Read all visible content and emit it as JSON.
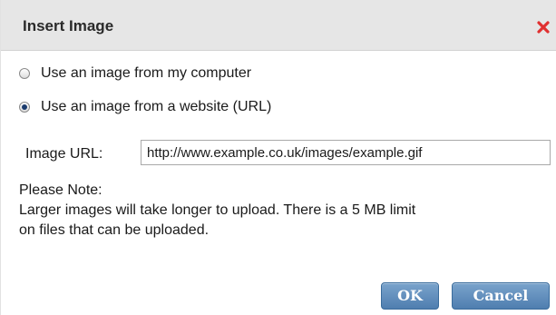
{
  "dialog": {
    "title": "Insert Image",
    "close_icon": "close-icon",
    "close_color": "#e03030"
  },
  "options": [
    {
      "label": "Use an image from my computer",
      "checked": false
    },
    {
      "label": "Use an image from a website (URL)",
      "checked": true
    }
  ],
  "url_field": {
    "label": "Image URL:",
    "value": "http://www.example.co.uk/images/example.gif"
  },
  "note": {
    "heading": "Please Note:",
    "line1": "Larger images will take longer to upload. There is a 5 MB limit",
    "line2": "on files that can be uploaded."
  },
  "buttons": {
    "ok_label": "OK",
    "cancel_label": "Cancel"
  },
  "colors": {
    "titlebar_bg": "#e6e6e6",
    "button_blue": "#5f8dbd"
  }
}
